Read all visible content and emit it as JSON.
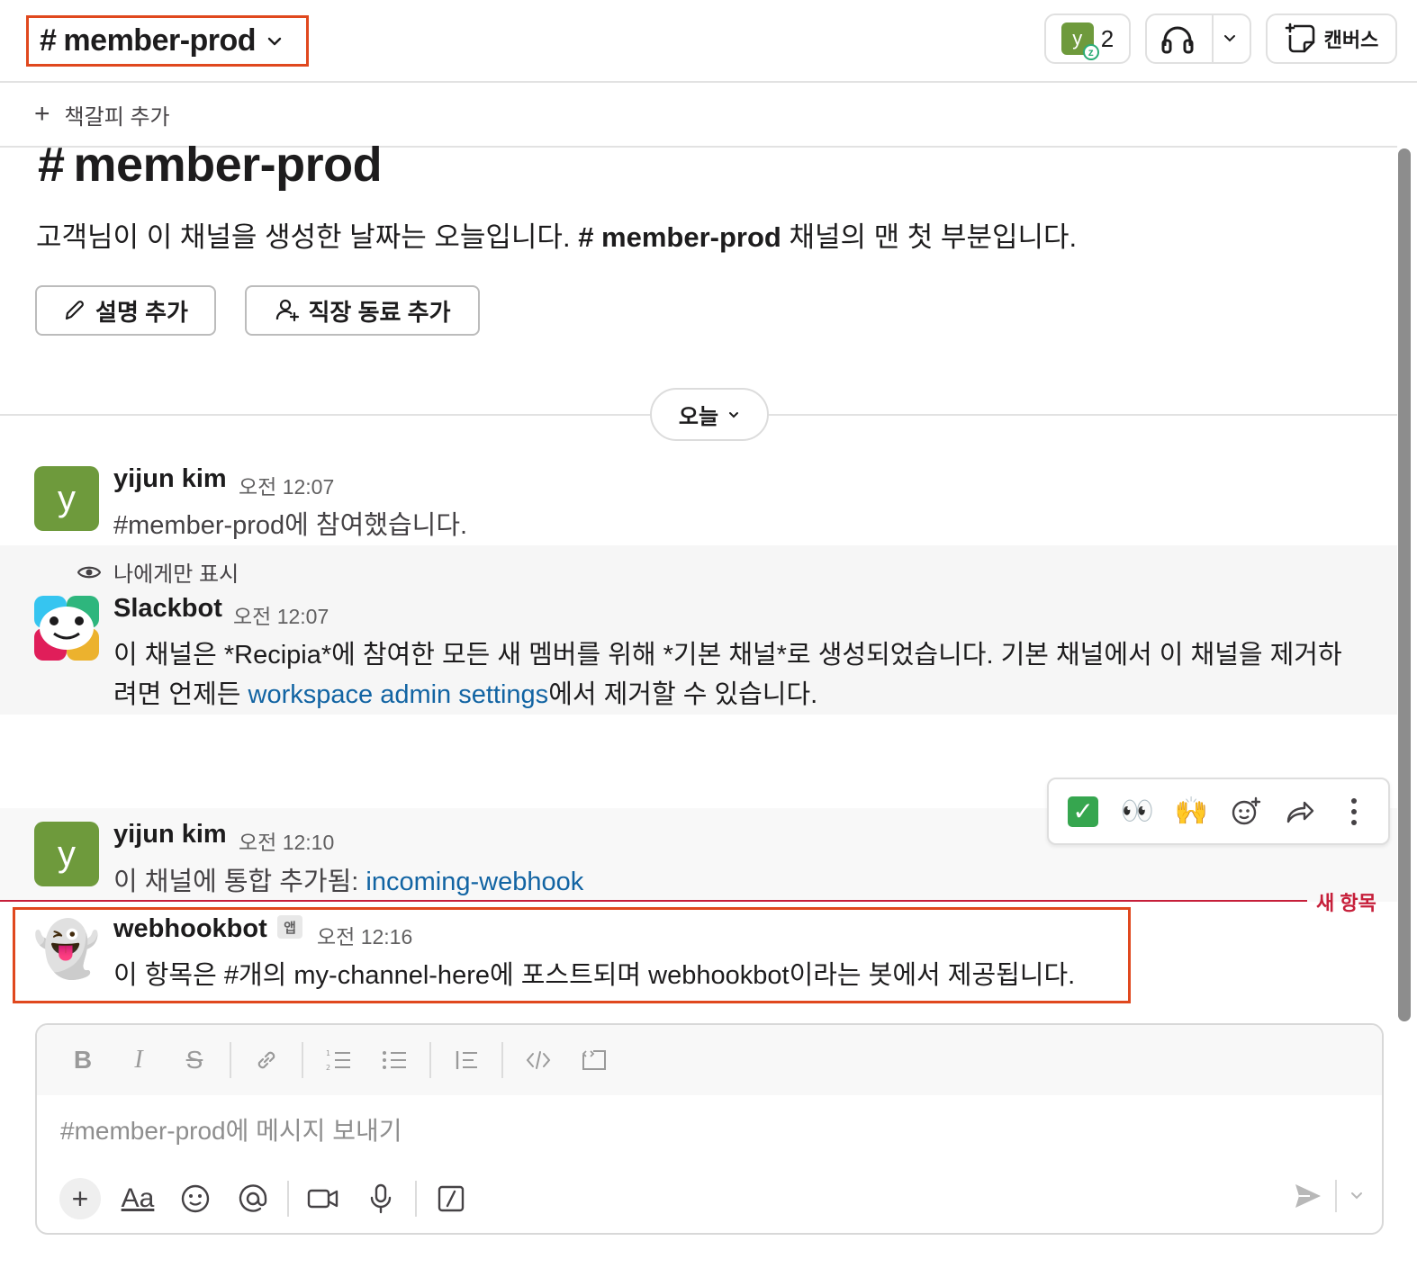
{
  "header": {
    "channel_name": "member-prod",
    "hash": "#",
    "member_avatar_letter": "y",
    "member_count": "2",
    "canvas_label": "캔버스"
  },
  "bookmarks": {
    "add_label": "책갈피 추가"
  },
  "intro": {
    "hash": "#",
    "title": "member-prod",
    "desc_prefix": "고객님이 이 채널을 생성한 날짜는 오늘입니다.",
    "desc_channel": "# member-prod",
    "desc_suffix": "채널의 맨 첫 부분입니다.",
    "add_description_label": "설명 추가",
    "add_coworker_label": "직장 동료 추가"
  },
  "date_divider": {
    "label": "오늘"
  },
  "messages": [
    {
      "avatar_letter": "y",
      "name": "yijun kim",
      "time": "오전 12:07",
      "text": "#member-prod에 참여했습니다."
    },
    {
      "visibility_note": "나에게만 표시",
      "name": "Slackbot",
      "time": "오전 12:07",
      "text_line1": "이 채널은 *Recipia*에 참여한 모든 새 멤버를 위해 *기본 채널*로 생성되었습니다. 기본 채널에서 이 채널을 제거하",
      "text_line2_prefix": "려면 언제든",
      "text_line2_link": "workspace admin settings",
      "text_line2_suffix": "에서 제거할 수 있습니다."
    },
    {
      "avatar_letter": "y",
      "name": "yijun kim",
      "time": "오전 12:10",
      "text_prefix": "이 채널에 통합 추가됨: ",
      "text_link": "incoming-webhook"
    },
    {
      "avatar_emoji": "👻",
      "name": "webhookbot",
      "badge": "앱",
      "time": "오전 12:16",
      "text": "이 항목은 #개의 my-channel-here에 포스트되며 webhookbot이라는 봇에서 제공됩니다."
    }
  ],
  "reaction_bar": {
    "check": "✓",
    "eyes": "👀",
    "raised_hands": "🙌"
  },
  "new_divider": {
    "label": "새 항목"
  },
  "composer": {
    "placeholder": "#member-prod에 메시지 보내기",
    "format_bold": "B",
    "format_italic": "I",
    "format_strike": "S",
    "text_style": "Aa"
  }
}
